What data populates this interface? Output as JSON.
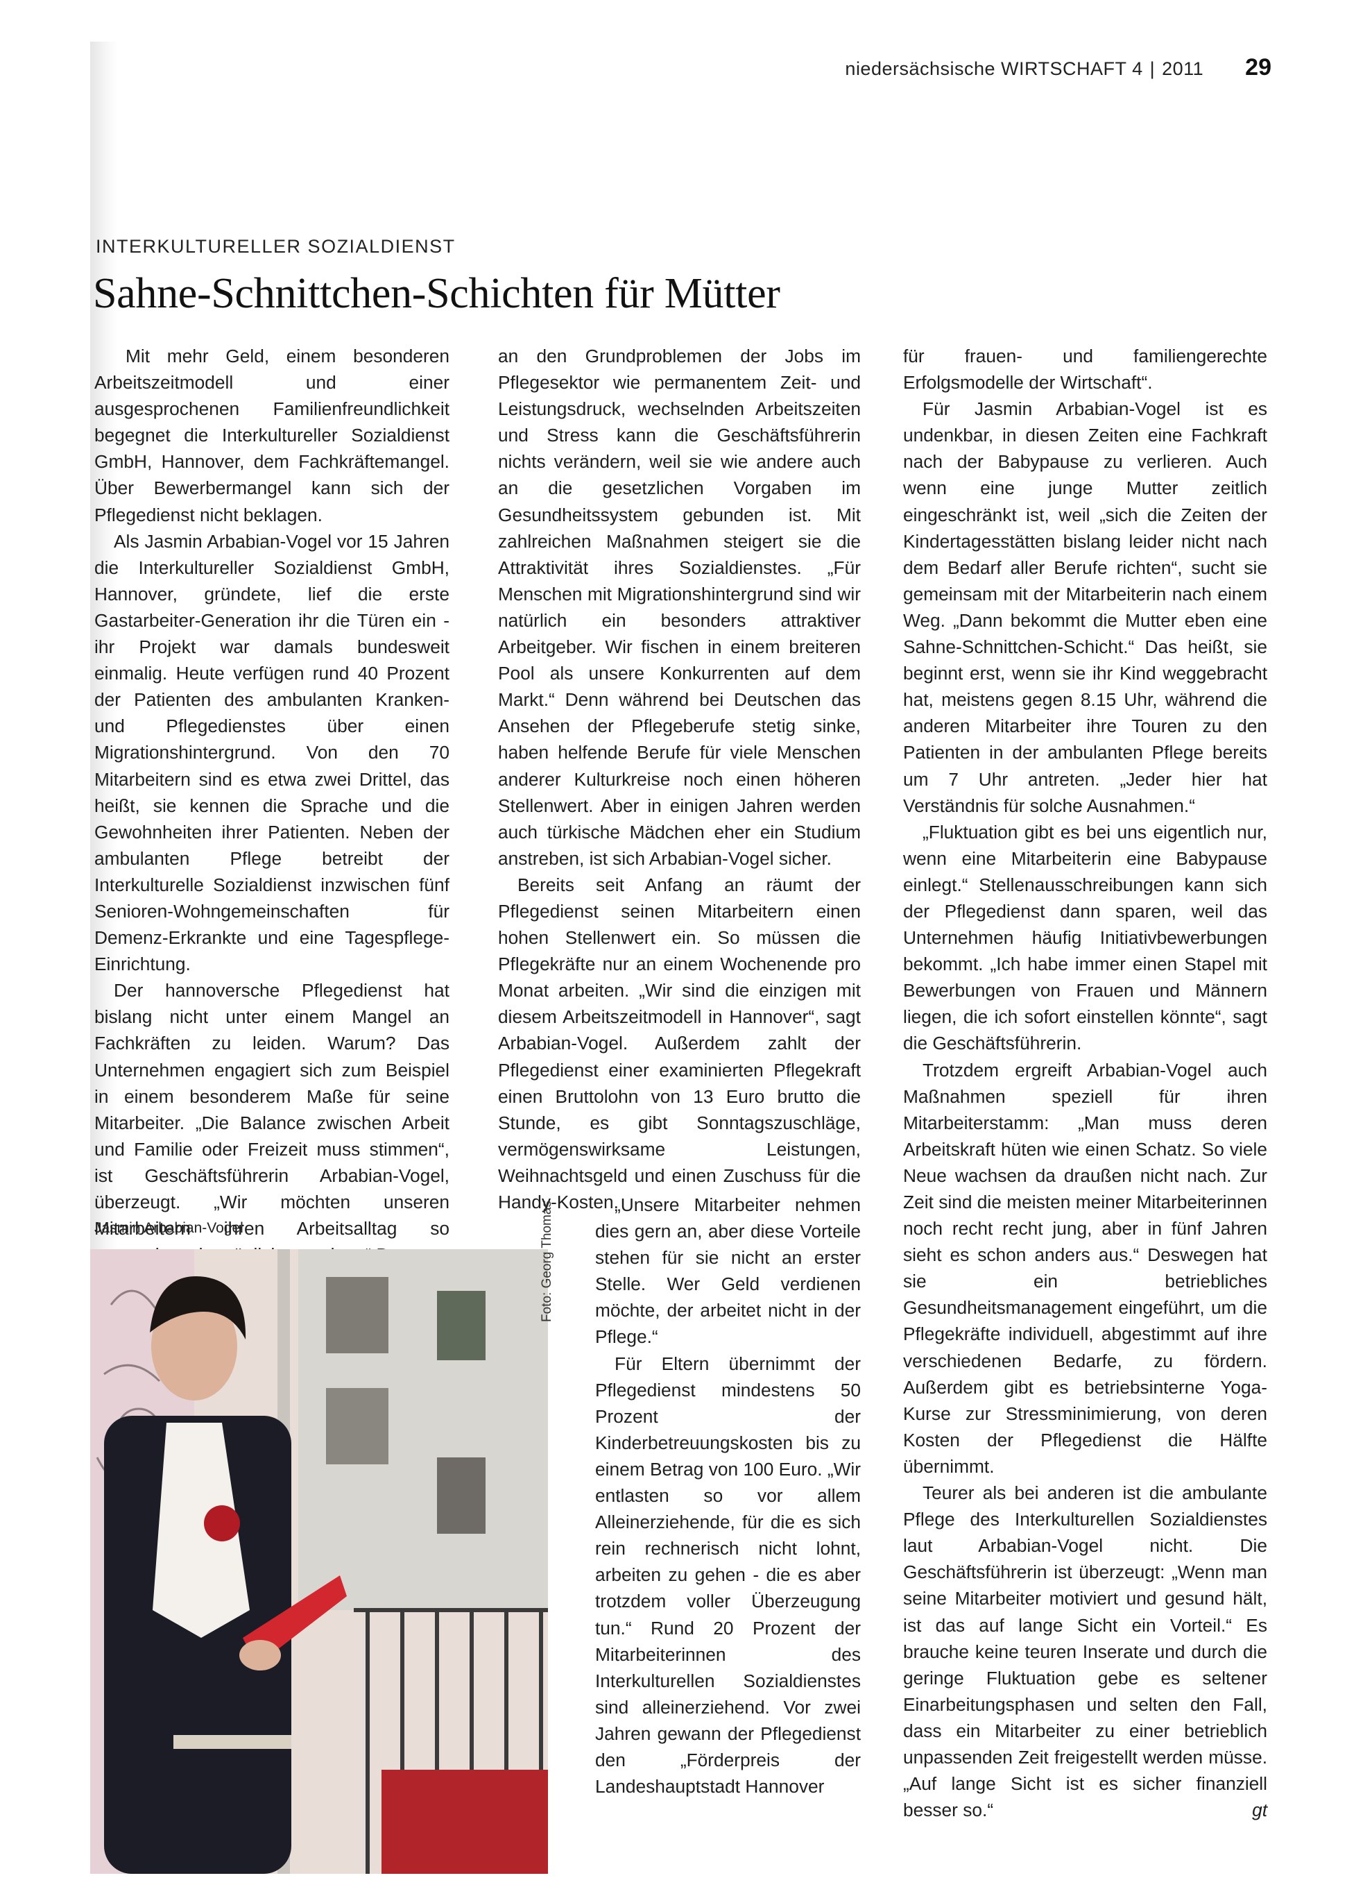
{
  "header": {
    "publication": "niedersächsische WIRTSCHAFT",
    "issue": "4",
    "year": "2011",
    "page_number": "29"
  },
  "article": {
    "kicker": "INTERKULTURELLER SOZIALDIENST",
    "headline": "Sahne-Schnittchen-Schichten für Mütter",
    "col1": [
      "Mit mehr Geld, einem besonderen Arbeitszeitmodell und einer ausgesprochenen Familienfreundlichkeit begegnet die Interkultureller Sozialdienst GmbH, Hannover, dem Fachkräftemangel. Über Bewerbermangel kann sich der Pflegedienst nicht beklagen.",
      "Als Jasmin Arbabian-Vogel vor 15 Jahren die Interkultureller Sozialdienst GmbH, Hannover, gründete, lief die erste Gastarbeiter-Generation ihr die Türen ein - ihr Projekt war damals bundesweit einmalig. Heute verfügen rund 40 Prozent der Patienten des ambulanten Kranken- und Pflegedienstes über einen Migrationshintergrund. Von den 70 Mitarbeitern sind es etwa zwei Drittel, das heißt, sie kennen die Sprache und die Gewohnheiten ihrer Patienten. Neben der ambulanten Pflege betreibt der Interkulturelle Sozialdienst inzwischen fünf Senioren-Wohngemeinschaften für Demenz-Erkrankte und eine Tagespflege-Einrichtung.",
      "Der hannoversche Pflegedienst hat bislang nicht unter einem Mangel an Fachkräften zu leiden. Warum? Das Unternehmen engagiert sich zum Beispiel in einem besonderem Maße für seine Mitarbeiter. „Die Balance zwischen Arbeit und Familie oder Freizeit muss stimmen“, ist Geschäftsführerin Arbabian-Vogel, überzeugt. „Wir möchten unseren Mitarbeitern ihren Arbeitsalltag so angenehm wie möglich gestalten.“ Denn"
    ],
    "col2": [
      "an den Grundproblemen der Jobs im Pflegesektor wie permanentem Zeit- und Leistungsdruck, wechselnden Arbeitszeiten und Stress kann die Geschäftsführerin nichts verändern, weil sie wie andere auch an die gesetzlichen Vorgaben im Gesundheitssystem gebunden ist. Mit zahlreichen Maßnahmen steigert sie die Attraktivität ihres Sozialdienstes. „Für Menschen mit Migrationshintergrund sind wir natürlich ein besonders attraktiver Arbeitgeber. Wir fischen in einem breiteren Pool als unsere Konkurrenten auf dem Markt.“ Denn während bei Deutschen das Ansehen der Pflegeberufe stetig sinke, haben helfende Berufe für viele Menschen anderer Kulturkreise noch einen höheren Stellenwert. Aber in einigen Jahren werden auch türkische Mädchen eher ein Studium anstreben, ist sich Arbabian-Vogel sicher.",
      "Bereits seit Anfang an räumt der Pflegedienst seinen Mitarbeitern einen hohen Stellenwert ein. So müssen die Pflegekräfte nur an einem Wochenende pro Monat arbeiten. „Wir sind die einzigen mit diesem Arbeitszeitmodell in Hannover“, sagt Arbabian-Vogel. Außerdem zahlt der Pflegedienst einer examinierten Pflegekraft einen Bruttolohn von 13 Euro brutto die Stunde, es gibt Sonntagszuschläge, vermögenswirksame Leistungen, Weihnachtsgeld und einen Zuschuss für die Handy-Kosten."
    ],
    "col2b": [
      "„Unsere Mitarbeiter nehmen dies gern an, aber diese Vorteile stehen für sie nicht an erster Stelle. Wer Geld verdienen möchte, der arbeitet nicht in der Pflege.“",
      "Für Eltern übernimmt der Pflegedienst mindestens 50 Prozent der Kinderbetreuungskosten bis zu einem Betrag von 100 Euro. „Wir entlasten so vor allem Alleinerziehende, für die es sich rein rechnerisch nicht lohnt, arbeiten zu gehen - die es aber trotzdem voller Überzeugung tun.“ Rund 20 Prozent der Mitarbeiterinnen des Interkulturellen Sozialdienstes sind alleinerziehend. Vor zwei Jahren gewann der Pflegedienst den „Förderpreis der Landeshauptstadt Hannover"
    ],
    "col3": [
      "für frauen- und familiengerechte Erfolgsmodelle der Wirtschaft“.",
      "Für Jasmin Arbabian-Vogel ist es undenkbar, in diesen Zeiten eine Fachkraft nach der Babypause zu verlieren. Auch wenn eine junge Mutter zeitlich eingeschränkt ist, weil „sich die Zeiten der Kindertagesstätten bislang leider nicht nach dem Bedarf aller Berufe richten“, sucht sie gemeinsam mit der Mitarbeiterin nach einem Weg. „Dann bekommt die Mutter eben eine Sahne-Schnittchen-Schicht.“ Das heißt, sie beginnt erst, wenn sie ihr Kind weggebracht hat, meistens gegen 8.15 Uhr, während die anderen Mitarbeiter ihre Touren zu den Patienten in der ambulanten Pflege bereits um 7 Uhr antreten. „Jeder hier hat Verständnis für solche Ausnahmen.“",
      "„Fluktuation gibt es bei uns eigentlich nur, wenn eine Mitarbeiterin eine Babypause einlegt.“ Stellenausschreibungen kann sich der Pflegedienst dann sparen, weil das Unternehmen häufig Initiativbewerbungen bekommt. „Ich habe immer einen Stapel mit Bewerbungen von Frauen und Männern liegen, die ich sofort einstellen könnte“, sagt die Geschäftsführerin.",
      "Trotzdem ergreift Arbabian-Vogel auch Maßnahmen speziell für ihren Mitarbeiterstamm: „Man muss deren Arbeitskraft hüten wie einen Schatz. So viele Neue wachsen da draußen nicht nach. Zur Zeit sind die meisten meiner Mitarbeiterinnen noch recht recht jung, aber in fünf Jahren sieht es schon anders aus.“ Deswegen hat sie ein betriebliches Gesundheitsmanagement eingeführt, um die Pflegekräfte individuell, abgestimmt auf ihre verschiedenen Bedarfe, zu fördern. Außerdem gibt es betriebsinterne Yoga-Kurse zur Stressminimierung, von deren Kosten der Pflegedienst die Hälfte übernimmt.",
      "Teurer als bei anderen ist die ambulante Pflege des Interkulturellen Sozialdienstes laut Arbabian-Vogel nicht. Die Geschäftsführerin ist überzeugt: „Wenn man seine Mitarbeiter motiviert und gesund hält, ist das auf lange Sicht ein Vorteil.“ Es brauche keine teuren Inserate und durch die geringe Fluktuation gebe es seltener Einarbeitungsphasen und selten den Fall, dass ein Mitarbeiter zu einer betrieblich unpassenden Zeit freigestellt werden müsse. „Auf lange Sicht ist es sicher finanziell besser so.“"
    ],
    "author_initials": "gt"
  },
  "photo": {
    "caption": "Jasmin Arbabian-Vogel",
    "credit": "Foto: Georg Thomas"
  }
}
